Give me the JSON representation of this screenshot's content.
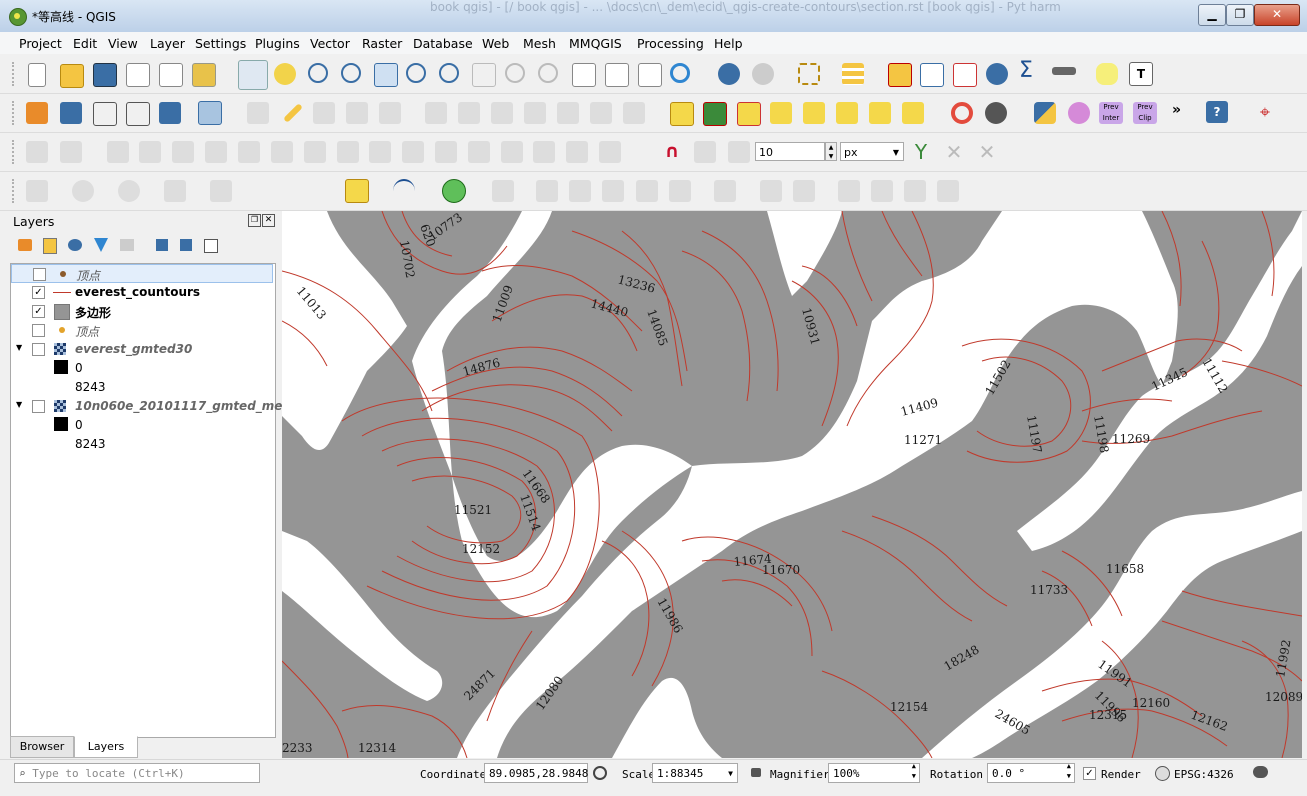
{
  "window": {
    "title": "*等高线 - QGIS",
    "background_text": "book qgis] - [/ book qgis] - ... \\docs\\cn\\_dem\\ecid\\_qgis-create-contours\\section.rst [book qgis] - Pyt harm"
  },
  "menu": [
    "Project",
    "Edit",
    "View",
    "Layer",
    "Settings",
    "Plugins",
    "Vector",
    "Raster",
    "Database",
    "Web",
    "Mesh",
    "MMQGIS",
    "Processing",
    "Help"
  ],
  "toolbar": {
    "snap_tolerance": "10",
    "snap_unit": "px",
    "prev_inter_label": "Prev Inter",
    "prev_clip_label": "Prev Clip"
  },
  "layers_panel": {
    "title": "Layers",
    "layers": [
      {
        "name": "顶点",
        "checked": false,
        "style": "italic",
        "symbol": "dot-brown"
      },
      {
        "name": "everest_countours",
        "checked": true,
        "style": "bold",
        "symbol": "line-red"
      },
      {
        "name": "多边形",
        "checked": true,
        "style": "bold",
        "symbol": "square-gray"
      },
      {
        "name": "顶点",
        "checked": false,
        "style": "italic",
        "symbol": "dot-orange"
      },
      {
        "name": "everest_gmted30",
        "checked": false,
        "style": "italic",
        "symbol": "raster"
      },
      {
        "name": "10n060e_20101117_gmted_me...",
        "checked": false,
        "style": "italic",
        "symbol": "raster"
      }
    ],
    "legend_values": {
      "min": "0",
      "max": "8243"
    },
    "tabs": [
      "Browser",
      "Layers"
    ]
  },
  "map": {
    "contour_labels": [
      "10702",
      "620",
      "10773",
      "11013",
      "13236",
      "11009",
      "14440",
      "14085",
      "10931",
      "14876",
      "11502",
      "11345",
      "11112",
      "11409",
      "11197",
      "11198",
      "11271",
      "11269",
      "11668",
      "11514",
      "11521",
      "12152",
      "11674",
      "11670",
      "11658",
      "11733",
      "11986",
      "18248",
      "11991",
      "11996",
      "12160",
      "11992",
      "12089",
      "24871",
      "12080",
      "12154",
      "12315",
      "12162",
      "24605",
      "2233",
      "12314"
    ],
    "colors": {
      "fill": "#959595",
      "contour": "#c0392b",
      "background": "#ffffff"
    }
  },
  "statusbar": {
    "locate_placeholder": "Type to locate (Ctrl+K)",
    "coordinate_label": "Coordinate",
    "coordinate_value": "89.0985,28.9848",
    "scale_label": "Scale",
    "scale_value": "1:88345",
    "magnifier_label": "Magnifier",
    "magnifier_value": "100%",
    "rotation_label": "Rotation",
    "rotation_value": "0.0 °",
    "render_label": "Render",
    "crs_label": "EPSG:4326"
  }
}
